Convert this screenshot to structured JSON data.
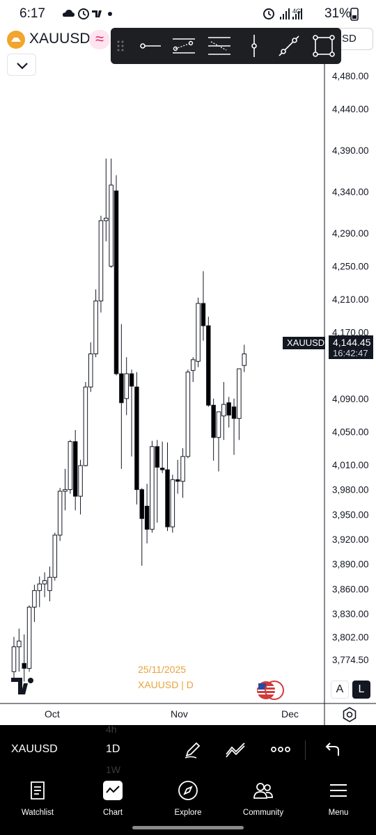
{
  "status_bar": {
    "time": "6:17",
    "battery": "31%",
    "network": "4G",
    "left_icons": [
      "cloud-icon",
      "alarm-clock-icon",
      "tradingview-icon",
      "dot-icon"
    ],
    "right_icons": [
      "alarm-icon",
      "signal-icon",
      "signal-icon",
      "battery-icon"
    ]
  },
  "header": {
    "symbol": "XAUUSD",
    "logo_color": "#f2a52c",
    "wave_badge": "≈",
    "collapse_icon": "chevron-down-icon",
    "currency_tab_partial": "SD"
  },
  "drawing_toolbar": {
    "tools": [
      "drag-handle-icon",
      "horizontal-ray-icon",
      "parallel-channel-icon",
      "fib-retracement-icon",
      "vertical-line-icon",
      "trend-line-icon",
      "rectangle-icon"
    ]
  },
  "chart": {
    "price_axis": [
      "4,480.00",
      "4,440.00",
      "4,390.00",
      "4,340.00",
      "4,290.00",
      "4,250.00",
      "4,210.00",
      "4,170.00",
      "4,090.00",
      "4,050.00",
      "4,010.00",
      "3,980.00",
      "3,950.00",
      "3,920.00",
      "3,890.00",
      "3,860.00",
      "3,830.00",
      "3,802.00",
      "3,774.50"
    ],
    "time_axis": [
      "Oct",
      "Nov",
      "Dec"
    ],
    "date_watermark": "25/11/2025",
    "symbol_watermark": "XAUUSD | D",
    "last_price_symbol": "XAUUSD",
    "last_price": "4,144.45",
    "countdown": "16:42:47",
    "scale_buttons": {
      "auto": "A",
      "log": "L"
    },
    "colors": {
      "up": "#ffffff",
      "down": "#000000",
      "border": "#131722",
      "axis": "#131722",
      "watermark": "#e8a33d"
    }
  },
  "bottom_toolbar": {
    "symbol": "XAUUSD",
    "interval": "1D",
    "interval_prev": "4h",
    "interval_next": "1W",
    "icons": [
      "pen-icon",
      "indicators-icon",
      "more-icon",
      "undo-icon"
    ]
  },
  "nav": {
    "items": [
      {
        "label": "Watchlist",
        "icon": "watchlist-icon"
      },
      {
        "label": "Chart",
        "icon": "chart-icon"
      },
      {
        "label": "Explore",
        "icon": "compass-icon"
      },
      {
        "label": "Community",
        "icon": "community-icon"
      },
      {
        "label": "Menu",
        "icon": "menu-icon"
      }
    ]
  },
  "chart_data": {
    "type": "candlestick",
    "symbol": "XAUUSD",
    "interval": "D",
    "ylim": [
      3747,
      4520
    ],
    "price_ticks": [
      4480,
      4440,
      4390,
      4340,
      4290,
      4250,
      4210,
      4170,
      4090,
      4050,
      4010,
      3980,
      3950,
      3920,
      3890,
      3860,
      3830,
      3802,
      3774.5
    ],
    "x_labels": [
      "Oct",
      "Nov",
      "Dec"
    ],
    "candles": [
      {
        "o": 3760,
        "h": 3802,
        "l": 3748,
        "c": 3790
      },
      {
        "o": 3790,
        "h": 3812,
        "l": 3760,
        "c": 3797
      },
      {
        "o": 3770,
        "h": 3805,
        "l": 3748,
        "c": 3764
      },
      {
        "o": 3764,
        "h": 3840,
        "l": 3760,
        "c": 3838
      },
      {
        "o": 3838,
        "h": 3865,
        "l": 3820,
        "c": 3858
      },
      {
        "o": 3858,
        "h": 3875,
        "l": 3838,
        "c": 3866
      },
      {
        "o": 3866,
        "h": 3880,
        "l": 3850,
        "c": 3870
      },
      {
        "o": 3858,
        "h": 3887,
        "l": 3845,
        "c": 3874
      },
      {
        "o": 3874,
        "h": 3928,
        "l": 3870,
        "c": 3925
      },
      {
        "o": 3925,
        "h": 3982,
        "l": 3918,
        "c": 3978
      },
      {
        "o": 3978,
        "h": 4005,
        "l": 3955,
        "c": 3980
      },
      {
        "o": 3980,
        "h": 4040,
        "l": 3975,
        "c": 4038
      },
      {
        "o": 4038,
        "h": 4052,
        "l": 3955,
        "c": 3972
      },
      {
        "o": 3972,
        "h": 4016,
        "l": 3950,
        "c": 4009
      },
      {
        "o": 4009,
        "h": 4110,
        "l": 4008,
        "c": 4104
      },
      {
        "o": 4104,
        "h": 4158,
        "l": 4098,
        "c": 4144
      },
      {
        "o": 4144,
        "h": 4222,
        "l": 4140,
        "c": 4208
      },
      {
        "o": 4208,
        "h": 4311,
        "l": 4194,
        "c": 4305
      },
      {
        "o": 4305,
        "h": 4380,
        "l": 4280,
        "c": 4308
      },
      {
        "o": 4250,
        "h": 4380,
        "l": 4248,
        "c": 4348
      },
      {
        "o": 4341,
        "h": 4360,
        "l": 4118,
        "c": 4120
      },
      {
        "o": 4120,
        "h": 4180,
        "l": 4005,
        "c": 4085
      },
      {
        "o": 4090,
        "h": 4140,
        "l": 4070,
        "c": 4120
      },
      {
        "o": 4120,
        "h": 4125,
        "l": 4020,
        "c": 4105
      },
      {
        "o": 4104,
        "h": 4122,
        "l": 3962,
        "c": 3980
      },
      {
        "o": 3980,
        "h": 3982,
        "l": 3888,
        "c": 3945
      },
      {
        "o": 3960,
        "h": 3987,
        "l": 3915,
        "c": 3932
      },
      {
        "o": 3932,
        "h": 4039,
        "l": 3928,
        "c": 4032
      },
      {
        "o": 4032,
        "h": 4040,
        "l": 3940,
        "c": 4007
      },
      {
        "o": 4006,
        "h": 4038,
        "l": 4000,
        "c": 4004
      },
      {
        "o": 4004,
        "h": 4037,
        "l": 3930,
        "c": 3935
      },
      {
        "o": 3935,
        "h": 3998,
        "l": 3928,
        "c": 3992
      },
      {
        "o": 3992,
        "h": 4016,
        "l": 3975,
        "c": 3990
      },
      {
        "o": 3990,
        "h": 4030,
        "l": 3970,
        "c": 4020
      },
      {
        "o": 4020,
        "h": 4125,
        "l": 4018,
        "c": 4122
      },
      {
        "o": 4124,
        "h": 4140,
        "l": 4110,
        "c": 4137
      },
      {
        "o": 4135,
        "h": 4212,
        "l": 4128,
        "c": 4205
      },
      {
        "o": 4205,
        "h": 4244,
        "l": 4160,
        "c": 4178
      },
      {
        "o": 4178,
        "h": 4189,
        "l": 4080,
        "c": 4082
      },
      {
        "o": 4082,
        "h": 4090,
        "l": 4015,
        "c": 4043
      },
      {
        "o": 4043,
        "h": 4073,
        "l": 4002,
        "c": 4074
      },
      {
        "o": 4069,
        "h": 4110,
        "l": 4040,
        "c": 4083
      },
      {
        "o": 4085,
        "h": 4092,
        "l": 4055,
        "c": 4070
      },
      {
        "o": 4080,
        "h": 4090,
        "l": 4022,
        "c": 4066
      },
      {
        "o": 4066,
        "h": 4118,
        "l": 4040,
        "c": 4126
      },
      {
        "o": 4130,
        "h": 4155,
        "l": 4122,
        "c": 4144
      }
    ]
  }
}
